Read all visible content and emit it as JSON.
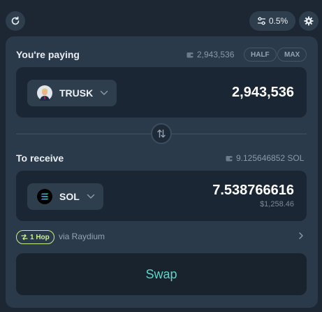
{
  "toolbar": {
    "refresh_icon": "refresh-icon",
    "slippage_label": "0.5%",
    "settings_icon": "gear-icon"
  },
  "paying": {
    "label": "You're paying",
    "balance": "2,943,536",
    "half_label": "HALF",
    "max_label": "MAX",
    "token": "TRUSK",
    "amount": "2,943,536"
  },
  "receiving": {
    "label": "To receive",
    "balance": "9.125646852 SOL",
    "token": "SOL",
    "amount": "7.538766616",
    "usd_value": "$1,258.46"
  },
  "route": {
    "hops": "1 Hop",
    "via": "via Raydium"
  },
  "swap_label": "Swap",
  "colors": {
    "accent": "#c7f284",
    "swap_text": "#5fd3c9",
    "card_bg": "#2b3a4a",
    "page_bg": "#1c2733"
  }
}
